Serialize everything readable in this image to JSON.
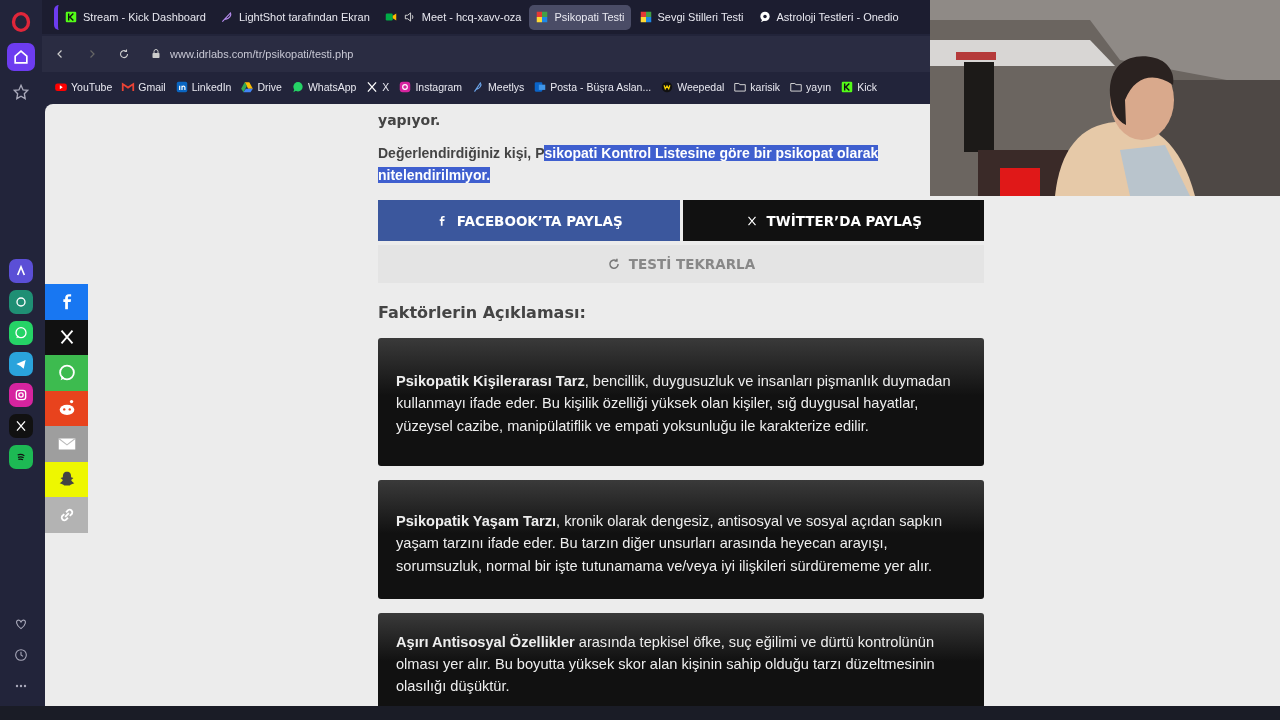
{
  "sidebar": {
    "top": [
      {
        "kind": "opera",
        "selected": false
      },
      {
        "kind": "home",
        "selected": true
      },
      {
        "kind": "star",
        "selected": false
      }
    ],
    "apps": [
      {
        "kind": "aria",
        "color": "#5b4fd6"
      },
      {
        "kind": "chatgpt",
        "color": "#1f8f74"
      },
      {
        "kind": "whatsapp",
        "color": "#25d366"
      },
      {
        "kind": "telegram",
        "color": "#2aa3dc"
      },
      {
        "kind": "instagram",
        "color": "#d6249f"
      },
      {
        "kind": "x",
        "color": "#111111"
      },
      {
        "kind": "spotify",
        "color": "#1db954"
      }
    ],
    "bottom": [
      {
        "kind": "heart"
      },
      {
        "kind": "clock"
      },
      {
        "kind": "more"
      }
    ]
  },
  "tabs": [
    {
      "title": "Stream - Kick Dashboard",
      "kind": "kick",
      "audio": false,
      "selected": false
    },
    {
      "title": "LightShot tarafından Ekran",
      "kind": "feather",
      "audio": false,
      "selected": false
    },
    {
      "title": "Meet - hcq-xavv-oza",
      "kind": "meet",
      "audio": true,
      "selected": false
    },
    {
      "title": "Psikopati Testi",
      "kind": "squares",
      "audio": false,
      "selected": true
    },
    {
      "title": "Sevgi Stilleri Testi",
      "kind": "squares",
      "audio": false,
      "selected": false
    },
    {
      "title": "Astroloji Testleri - Onedio",
      "kind": "bubble",
      "audio": false,
      "selected": false
    }
  ],
  "address": {
    "url": "www.idrlabs.com/tr/psikopati/testi.php"
  },
  "bookmarks": [
    {
      "label": "YouTube",
      "kind": "youtube"
    },
    {
      "label": "Gmail",
      "kind": "gmail"
    },
    {
      "label": "LinkedIn",
      "kind": "linkedin"
    },
    {
      "label": "Drive",
      "kind": "drive"
    },
    {
      "label": "WhatsApp",
      "kind": "whatsapp"
    },
    {
      "label": "X",
      "kind": "x"
    },
    {
      "label": "Instagram",
      "kind": "instagram"
    },
    {
      "label": "Meetlys",
      "kind": "meetlys"
    },
    {
      "label": "Posta - Büşra Aslan...",
      "kind": "outlook"
    },
    {
      "label": "Weepedal",
      "kind": "weepedal"
    },
    {
      "label": "karisik",
      "kind": "folder"
    },
    {
      "label": "yayın",
      "kind": "folder"
    },
    {
      "label": "Kick",
      "kind": "kick"
    }
  ],
  "share_bar": [
    {
      "kind": "facebook",
      "color": "#1877f2"
    },
    {
      "kind": "x",
      "color": "#111111"
    },
    {
      "kind": "whatsapp",
      "color": "#3dbb4f"
    },
    {
      "kind": "reddit",
      "color": "#e8431d"
    },
    {
      "kind": "email",
      "color": "#9e9e9e"
    },
    {
      "kind": "snapchat",
      "color": "#eef700"
    },
    {
      "kind": "link",
      "color": "#b3b3b3"
    }
  ],
  "content": {
    "intro_tail": "yapıyor.",
    "result": {
      "text": "Değerlendirdiğiniz kişi, P",
      "selected_text": "sikopati Kontrol Listesine göre bir psikopat olarak nitelendirilmiyor."
    },
    "share_buttons": [
      {
        "label": "FACEBOOK’TA PAYLAŞ",
        "kind": "facebook"
      },
      {
        "label": "TWİTTER’DA PAYLAŞ",
        "kind": "x"
      }
    ],
    "retry_button": "TESTİ TEKRARLA",
    "heading": "Faktörlerin Açıklaması:",
    "factors": [
      "**Psikopatik Kişilerarası Tarz**, bencillik, duygusuzluk ve insanları pişmanlık duymadan kullanmayı ifade eder. Bu kişilik özelliği yüksek olan kişiler, sığ duygusal hayatlar, yüzeysel cazibe, manipülatiflik ve empati yoksunluğu ile karakterize edilir.",
      "**Psikopatik Yaşam Tarzı**, kronik olarak dengesiz, antisosyal ve sosyal açıdan sapkın yaşam tarzını ifade eder. Bu tarzın diğer unsurları arasında heyecan arayışı, sorumsuzluk, normal bir işte tutunamama ve/veya iyi ilişkileri sürdürememe yer alır.",
      "**Aşırı Antisosyal Özellikler** arasında tepkisel öfke, suç eğilimi ve dürtü kontrolünün olması yer alır. Bu boyutta yüksek skor alan kişinin sahip olduğu tarzı düzeltmesinin olasılığı düşüktür."
    ]
  }
}
